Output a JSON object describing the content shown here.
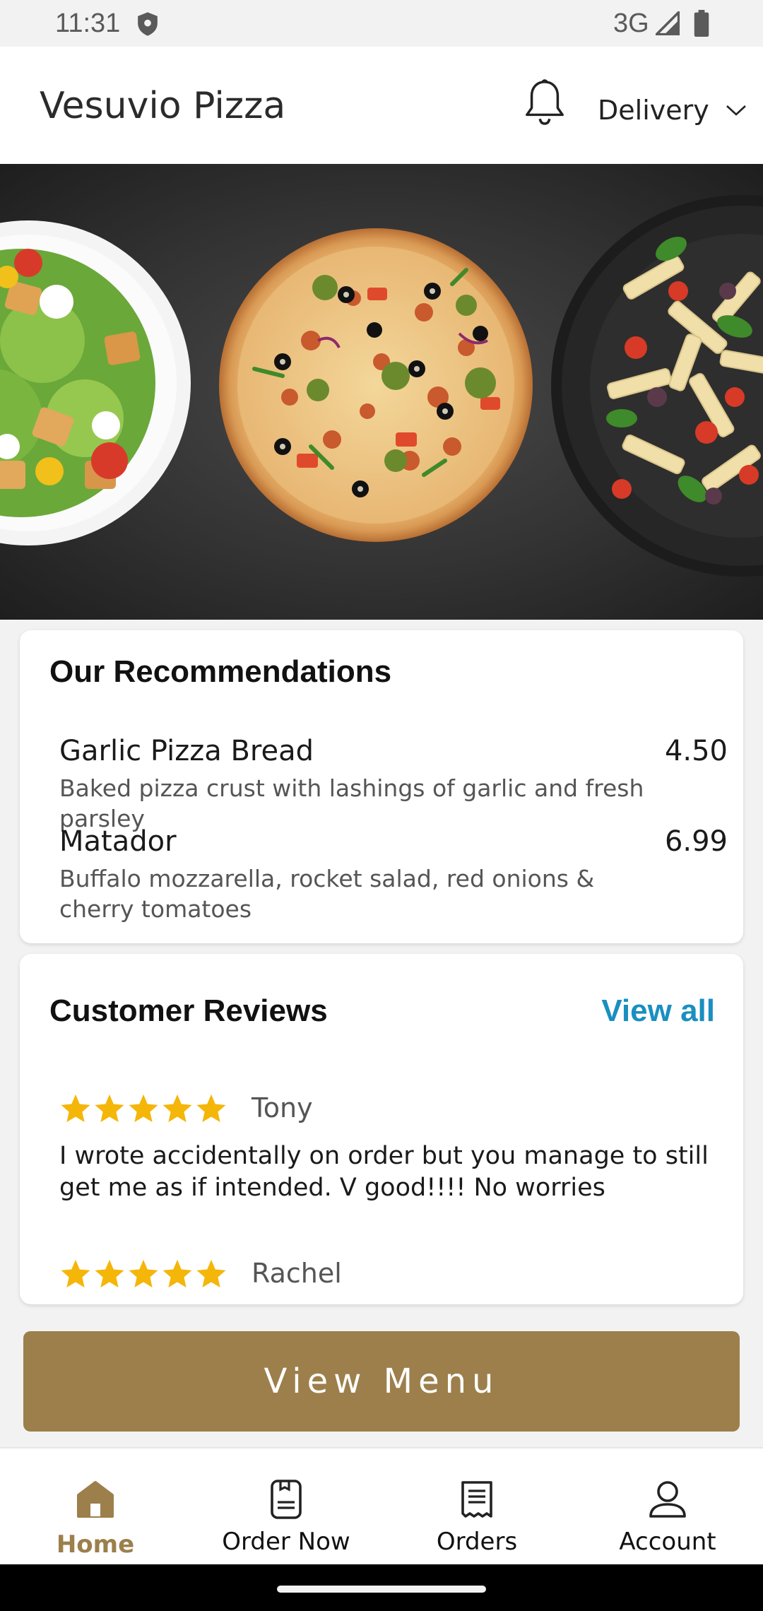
{
  "status_bar": {
    "time": "11:31",
    "network": "3G"
  },
  "header": {
    "title": "Vesuvio Pizza",
    "mode": "Delivery"
  },
  "recommendations": {
    "title": "Our Recommendations",
    "items": [
      {
        "name": "Garlic Pizza Bread",
        "price": "4.50",
        "description": "Baked pizza crust with lashings of garlic and fresh parsley"
      },
      {
        "name": "Matador",
        "price": "6.99",
        "description": "Buffalo mozzarella, rocket salad, red onions & cherry tomatoes"
      }
    ]
  },
  "reviews": {
    "title": "Customer Reviews",
    "view_all": "View all",
    "items": [
      {
        "rating": 5,
        "author": "Tony",
        "text": "I wrote accidentally on order but you manage to still get me as if intended. V good!!!! No worries"
      },
      {
        "rating": 5,
        "author": "Rachel",
        "text": ""
      }
    ]
  },
  "cta": {
    "label": "View Menu"
  },
  "bottom_nav": {
    "items": [
      {
        "label": "Home",
        "icon": "home-icon",
        "active": true
      },
      {
        "label": "Order Now",
        "icon": "order-icon",
        "active": false
      },
      {
        "label": "Orders",
        "icon": "receipt-icon",
        "active": false
      },
      {
        "label": "Account",
        "icon": "person-icon",
        "active": false
      }
    ]
  },
  "colors": {
    "accent": "#9c7f4b",
    "link": "#1a8fc0",
    "star": "#f5b60a"
  }
}
